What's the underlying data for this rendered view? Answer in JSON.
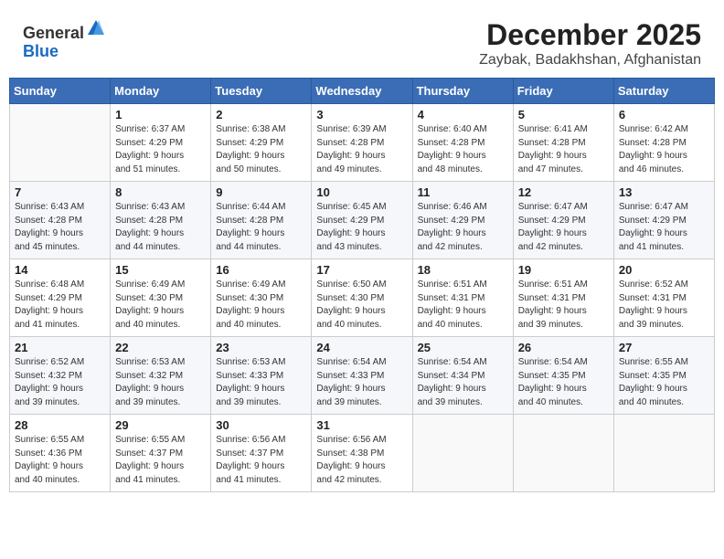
{
  "header": {
    "logo_line1": "General",
    "logo_line2": "Blue",
    "title": "December 2025",
    "subtitle": "Zaybak, Badakhshan, Afghanistan"
  },
  "calendar": {
    "days_of_week": [
      "Sunday",
      "Monday",
      "Tuesday",
      "Wednesday",
      "Thursday",
      "Friday",
      "Saturday"
    ],
    "weeks": [
      [
        {
          "day": "",
          "sunrise": "",
          "sunset": "",
          "daylight": ""
        },
        {
          "day": "1",
          "sunrise": "Sunrise: 6:37 AM",
          "sunset": "Sunset: 4:29 PM",
          "daylight": "Daylight: 9 hours and 51 minutes."
        },
        {
          "day": "2",
          "sunrise": "Sunrise: 6:38 AM",
          "sunset": "Sunset: 4:29 PM",
          "daylight": "Daylight: 9 hours and 50 minutes."
        },
        {
          "day": "3",
          "sunrise": "Sunrise: 6:39 AM",
          "sunset": "Sunset: 4:28 PM",
          "daylight": "Daylight: 9 hours and 49 minutes."
        },
        {
          "day": "4",
          "sunrise": "Sunrise: 6:40 AM",
          "sunset": "Sunset: 4:28 PM",
          "daylight": "Daylight: 9 hours and 48 minutes."
        },
        {
          "day": "5",
          "sunrise": "Sunrise: 6:41 AM",
          "sunset": "Sunset: 4:28 PM",
          "daylight": "Daylight: 9 hours and 47 minutes."
        },
        {
          "day": "6",
          "sunrise": "Sunrise: 6:42 AM",
          "sunset": "Sunset: 4:28 PM",
          "daylight": "Daylight: 9 hours and 46 minutes."
        }
      ],
      [
        {
          "day": "7",
          "sunrise": "Sunrise: 6:43 AM",
          "sunset": "Sunset: 4:28 PM",
          "daylight": "Daylight: 9 hours and 45 minutes."
        },
        {
          "day": "8",
          "sunrise": "Sunrise: 6:43 AM",
          "sunset": "Sunset: 4:28 PM",
          "daylight": "Daylight: 9 hours and 44 minutes."
        },
        {
          "day": "9",
          "sunrise": "Sunrise: 6:44 AM",
          "sunset": "Sunset: 4:28 PM",
          "daylight": "Daylight: 9 hours and 44 minutes."
        },
        {
          "day": "10",
          "sunrise": "Sunrise: 6:45 AM",
          "sunset": "Sunset: 4:29 PM",
          "daylight": "Daylight: 9 hours and 43 minutes."
        },
        {
          "day": "11",
          "sunrise": "Sunrise: 6:46 AM",
          "sunset": "Sunset: 4:29 PM",
          "daylight": "Daylight: 9 hours and 42 minutes."
        },
        {
          "day": "12",
          "sunrise": "Sunrise: 6:47 AM",
          "sunset": "Sunset: 4:29 PM",
          "daylight": "Daylight: 9 hours and 42 minutes."
        },
        {
          "day": "13",
          "sunrise": "Sunrise: 6:47 AM",
          "sunset": "Sunset: 4:29 PM",
          "daylight": "Daylight: 9 hours and 41 minutes."
        }
      ],
      [
        {
          "day": "14",
          "sunrise": "Sunrise: 6:48 AM",
          "sunset": "Sunset: 4:29 PM",
          "daylight": "Daylight: 9 hours and 41 minutes."
        },
        {
          "day": "15",
          "sunrise": "Sunrise: 6:49 AM",
          "sunset": "Sunset: 4:30 PM",
          "daylight": "Daylight: 9 hours and 40 minutes."
        },
        {
          "day": "16",
          "sunrise": "Sunrise: 6:49 AM",
          "sunset": "Sunset: 4:30 PM",
          "daylight": "Daylight: 9 hours and 40 minutes."
        },
        {
          "day": "17",
          "sunrise": "Sunrise: 6:50 AM",
          "sunset": "Sunset: 4:30 PM",
          "daylight": "Daylight: 9 hours and 40 minutes."
        },
        {
          "day": "18",
          "sunrise": "Sunrise: 6:51 AM",
          "sunset": "Sunset: 4:31 PM",
          "daylight": "Daylight: 9 hours and 40 minutes."
        },
        {
          "day": "19",
          "sunrise": "Sunrise: 6:51 AM",
          "sunset": "Sunset: 4:31 PM",
          "daylight": "Daylight: 9 hours and 39 minutes."
        },
        {
          "day": "20",
          "sunrise": "Sunrise: 6:52 AM",
          "sunset": "Sunset: 4:31 PM",
          "daylight": "Daylight: 9 hours and 39 minutes."
        }
      ],
      [
        {
          "day": "21",
          "sunrise": "Sunrise: 6:52 AM",
          "sunset": "Sunset: 4:32 PM",
          "daylight": "Daylight: 9 hours and 39 minutes."
        },
        {
          "day": "22",
          "sunrise": "Sunrise: 6:53 AM",
          "sunset": "Sunset: 4:32 PM",
          "daylight": "Daylight: 9 hours and 39 minutes."
        },
        {
          "day": "23",
          "sunrise": "Sunrise: 6:53 AM",
          "sunset": "Sunset: 4:33 PM",
          "daylight": "Daylight: 9 hours and 39 minutes."
        },
        {
          "day": "24",
          "sunrise": "Sunrise: 6:54 AM",
          "sunset": "Sunset: 4:33 PM",
          "daylight": "Daylight: 9 hours and 39 minutes."
        },
        {
          "day": "25",
          "sunrise": "Sunrise: 6:54 AM",
          "sunset": "Sunset: 4:34 PM",
          "daylight": "Daylight: 9 hours and 39 minutes."
        },
        {
          "day": "26",
          "sunrise": "Sunrise: 6:54 AM",
          "sunset": "Sunset: 4:35 PM",
          "daylight": "Daylight: 9 hours and 40 minutes."
        },
        {
          "day": "27",
          "sunrise": "Sunrise: 6:55 AM",
          "sunset": "Sunset: 4:35 PM",
          "daylight": "Daylight: 9 hours and 40 minutes."
        }
      ],
      [
        {
          "day": "28",
          "sunrise": "Sunrise: 6:55 AM",
          "sunset": "Sunset: 4:36 PM",
          "daylight": "Daylight: 9 hours and 40 minutes."
        },
        {
          "day": "29",
          "sunrise": "Sunrise: 6:55 AM",
          "sunset": "Sunset: 4:37 PM",
          "daylight": "Daylight: 9 hours and 41 minutes."
        },
        {
          "day": "30",
          "sunrise": "Sunrise: 6:56 AM",
          "sunset": "Sunset: 4:37 PM",
          "daylight": "Daylight: 9 hours and 41 minutes."
        },
        {
          "day": "31",
          "sunrise": "Sunrise: 6:56 AM",
          "sunset": "Sunset: 4:38 PM",
          "daylight": "Daylight: 9 hours and 42 minutes."
        },
        {
          "day": "",
          "sunrise": "",
          "sunset": "",
          "daylight": ""
        },
        {
          "day": "",
          "sunrise": "",
          "sunset": "",
          "daylight": ""
        },
        {
          "day": "",
          "sunrise": "",
          "sunset": "",
          "daylight": ""
        }
      ]
    ]
  }
}
